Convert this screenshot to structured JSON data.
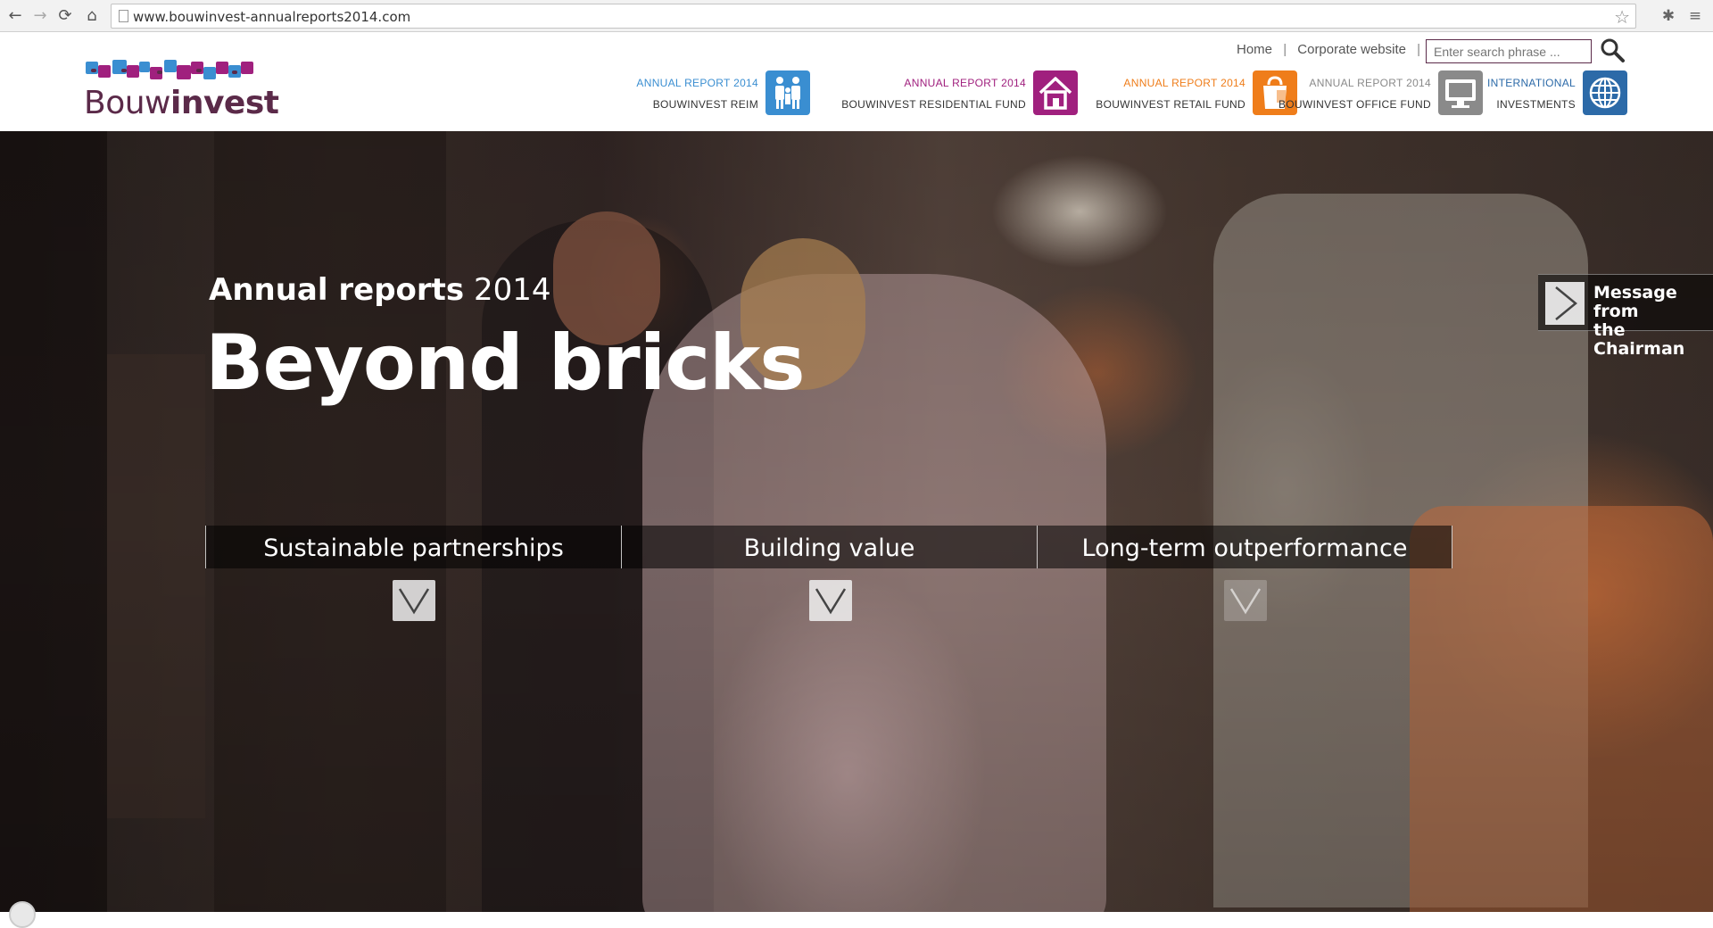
{
  "browser": {
    "url": "www.bouwinvest-annualreports2014.com",
    "back_icon": "←",
    "forward_icon": "→",
    "reload_icon": "⟳",
    "home_icon": "⌂",
    "star_icon": "☆",
    "puzzle_icon": "✱",
    "menu_icon": "≡"
  },
  "header": {
    "logo_regular": "Bouw",
    "logo_bold": "invest",
    "top_links": {
      "home": "Home",
      "corporate": "Corporate website",
      "separator": "|"
    },
    "search": {
      "placeholder": "Enter search phrase ..."
    },
    "funds": [
      {
        "line1": "ANNUAL REPORT 2014",
        "line2": "BOUWINVEST REIM",
        "color": "#3a8ed1",
        "icon": "people-icon"
      },
      {
        "line1": "ANNUAL REPORT 2014",
        "line2": "BOUWINVEST RESIDENTIAL FUND",
        "color": "#a0207e",
        "icon": "house-icon"
      },
      {
        "line1": "ANNUAL REPORT 2014",
        "line2": "BOUWINVEST RETAIL FUND",
        "color": "#ef7d1a",
        "icon": "shopping-bag-icon"
      },
      {
        "line1": "ANNUAL REPORT 2014",
        "line2": "BOUWINVEST OFFICE FUND",
        "color": "#8a8a8a",
        "icon": "monitor-icon"
      },
      {
        "line1": "INTERNATIONAL",
        "line2": "INVESTMENTS",
        "color": "#2c6aa8",
        "icon": "globe-icon"
      }
    ]
  },
  "hero": {
    "subtitle_bold": "Annual reports",
    "subtitle_year": "2014",
    "title": "Beyond bricks",
    "message": {
      "line1": "Message from",
      "line2": "the Chairman"
    },
    "tabs": [
      {
        "label": "Sustainable partnerships"
      },
      {
        "label": "Building value"
      },
      {
        "label": "Long-term outperformance"
      }
    ]
  }
}
